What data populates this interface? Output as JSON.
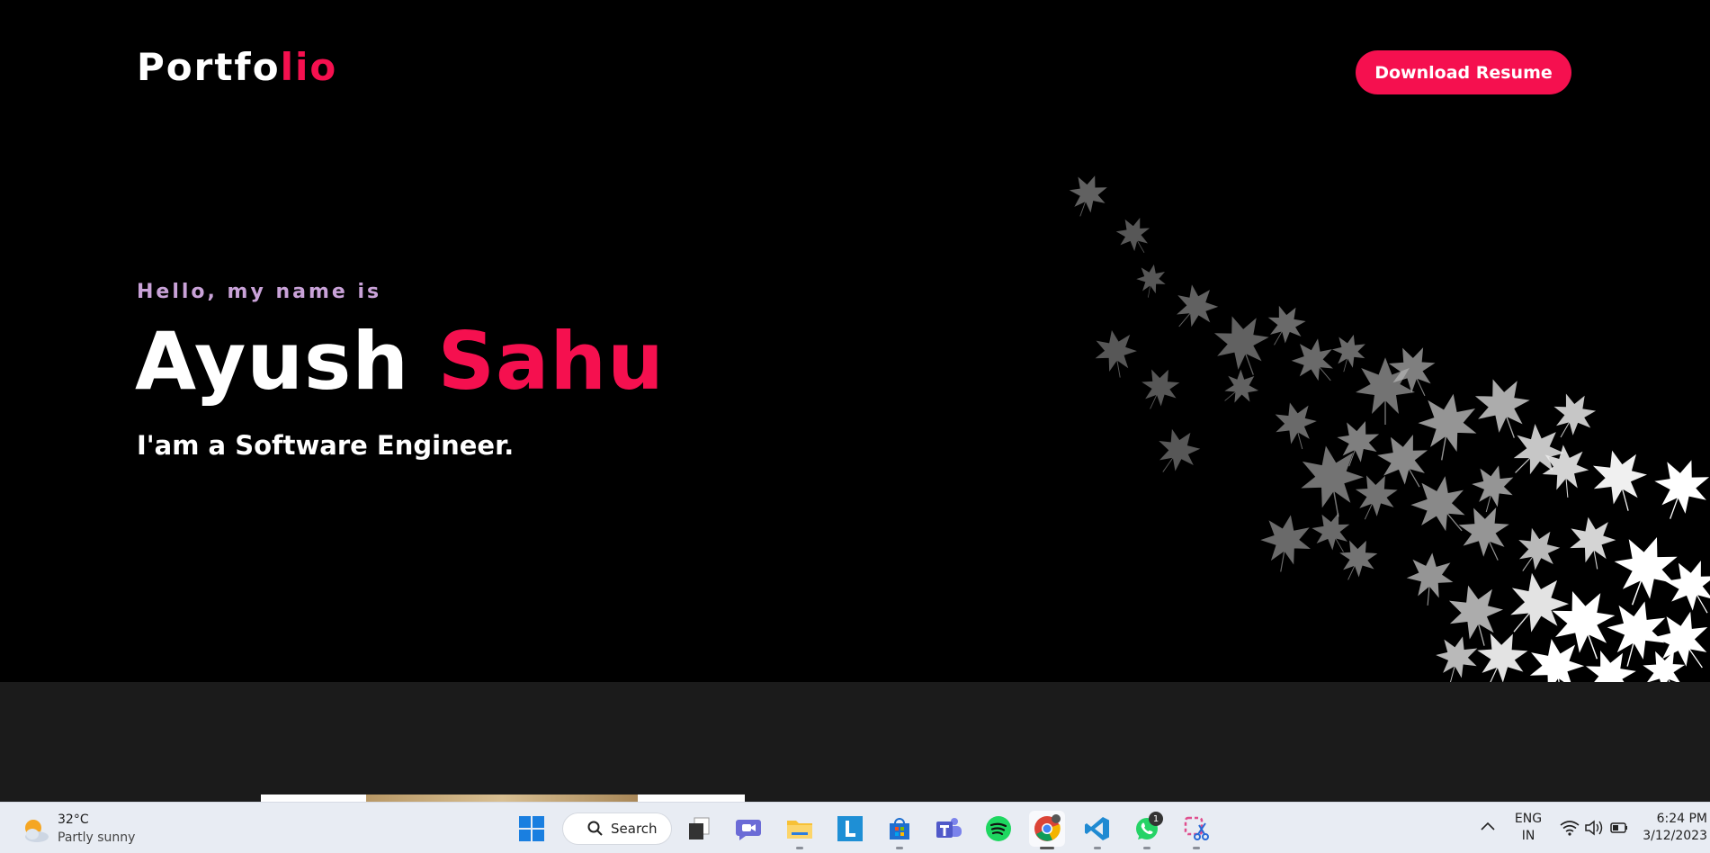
{
  "header": {
    "logo_main": "Portfo",
    "logo_accent": "lio",
    "download_label": "Download Resume"
  },
  "hero": {
    "greeting": "Hello, my name is",
    "first_name": "Ayush",
    "last_name": "Sahu",
    "role": "I'am a Software Engineer."
  },
  "taskbar": {
    "weather": {
      "temp": "32°C",
      "desc": "Partly sunny",
      "icon": "partly-sunny-icon"
    },
    "search_label": "Search",
    "apps": [
      "windows-start-icon",
      "task-view-icon",
      "chat-icon",
      "file-explorer-icon",
      "l-app-icon",
      "microsoft-store-icon",
      "teams-icon",
      "spotify-icon",
      "chrome-icon",
      "vscode-icon",
      "whatsapp-icon",
      "snipping-tool-icon"
    ],
    "whatsapp_badge": "1",
    "language": {
      "line1": "ENG",
      "line2": "IN"
    },
    "time": "6:24 PM",
    "date": "3/12/2023"
  },
  "colors": {
    "accent": "#f5104f",
    "greeting": "#c9a2d8",
    "background": "#000000",
    "section": "#1b1b1b"
  }
}
